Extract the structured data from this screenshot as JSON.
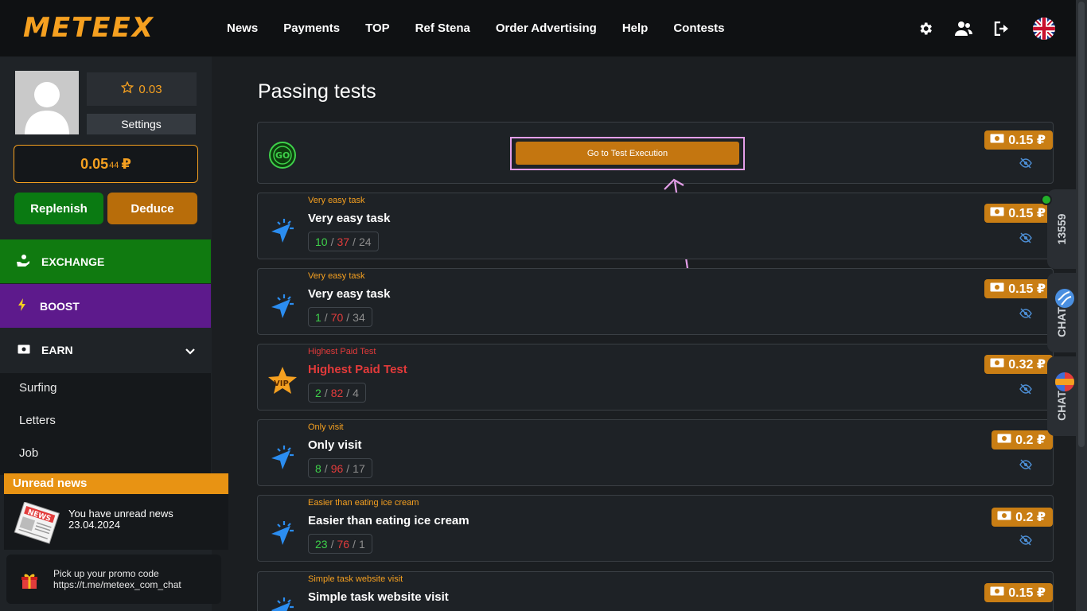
{
  "header": {
    "logo": "METEEX",
    "nav": [
      "News",
      "Payments",
      "TOP",
      "Ref Stena",
      "Order Advertising",
      "Help",
      "Contests"
    ]
  },
  "sidebar": {
    "rating": "0.03",
    "settings_label": "Settings",
    "balance_main": "0.05",
    "balance_small": "44",
    "currency": "₽",
    "replenish_label": "Replenish",
    "deduce_label": "Deduce",
    "menu": {
      "exchange": "EXCHANGE",
      "boost": "BOOST",
      "earn": "EARN"
    },
    "submenu": [
      "Surfing",
      "Letters",
      "Job"
    ],
    "news": {
      "header": "Unread news",
      "text": "You have unread news",
      "date": "23.04.2024"
    },
    "promo": {
      "line1": "Pick up your promo code",
      "line2": "https://t.me/meteex_com_chat"
    }
  },
  "main": {
    "title": "Passing tests",
    "first_task": {
      "button_label": "Go to Test Execution",
      "price": "0.15 ₽"
    },
    "tasks": [
      {
        "label": "Very easy task",
        "title": "Very easy task",
        "a": "10",
        "b": "37",
        "c": "24",
        "price": "0.15 ₽"
      },
      {
        "label": "Very easy task",
        "title": "Very easy task",
        "a": "1",
        "b": "70",
        "c": "34",
        "price": "0.15 ₽"
      },
      {
        "label": "Highest Paid Test",
        "title": "Highest Paid Test",
        "a": "2",
        "b": "82",
        "c": "4",
        "price": "0.32 ₽"
      },
      {
        "label": "Only visit",
        "title": "Only visit",
        "a": "8",
        "b": "96",
        "c": "17",
        "price": "0.2 ₽"
      },
      {
        "label": "Easier than eating ice cream",
        "title": "Easier than eating ice cream",
        "a": "23",
        "b": "76",
        "c": "1",
        "price": "0.2 ₽"
      },
      {
        "label": "Simple task website visit",
        "title": "Simple task website visit",
        "a": "",
        "b": "",
        "c": "",
        "price": "0.15 ₽"
      }
    ]
  },
  "side_tabs": {
    "online_count": "13559",
    "chat1": "CHAT",
    "chat2": "CHAT"
  },
  "colors": {
    "accent": "#f5a020",
    "exchange": "#107a10",
    "boost": "#5d1a8c",
    "highlight": "#e49ee8"
  }
}
